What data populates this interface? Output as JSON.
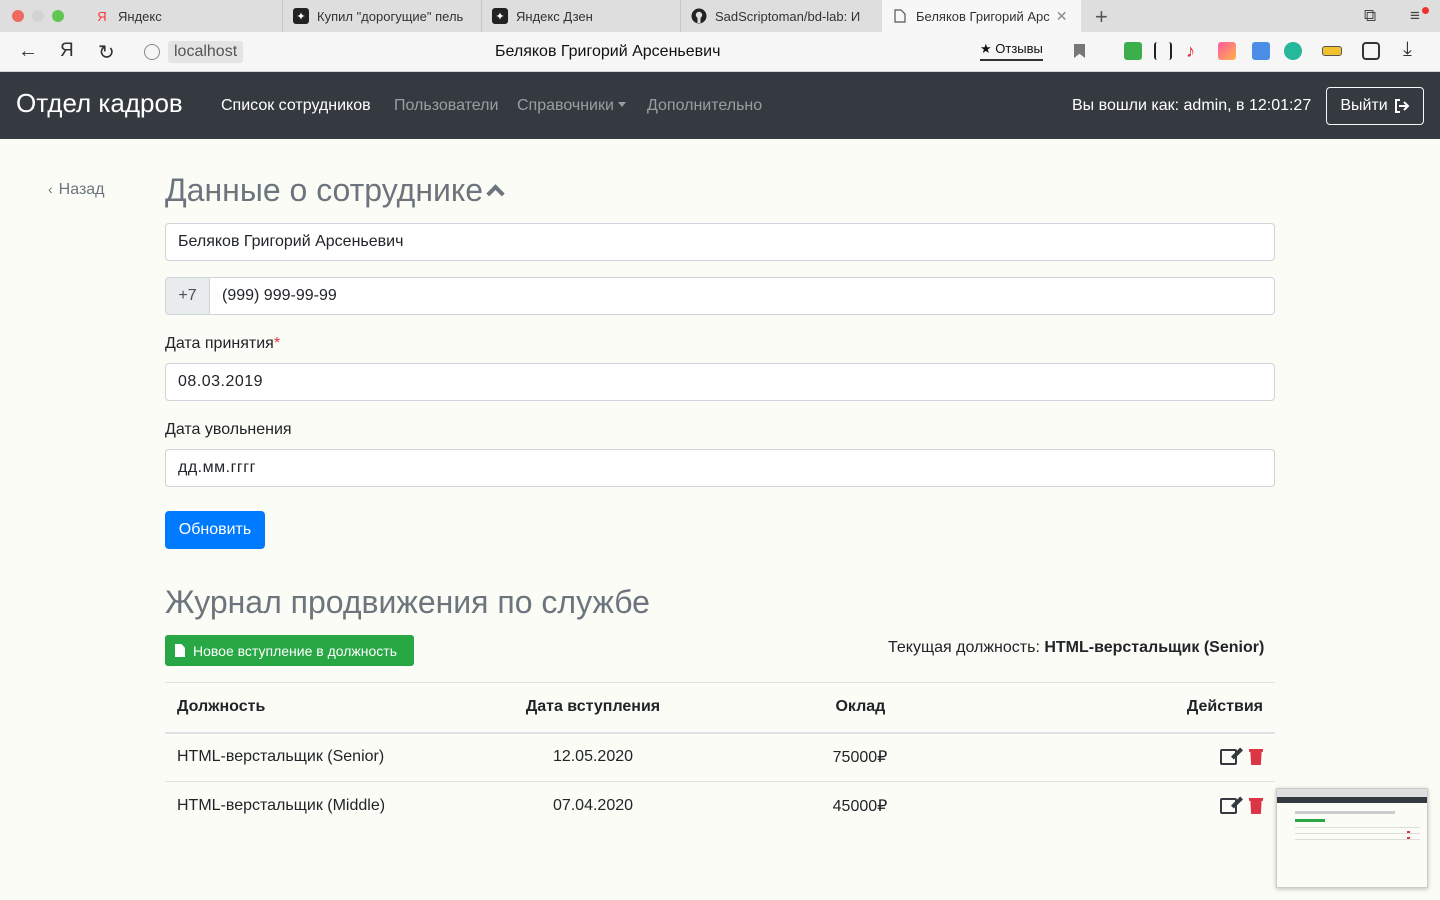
{
  "browser": {
    "tabs": [
      {
        "label": "Яндекс",
        "icon": "yandex-icon"
      },
      {
        "label": "Купил \"дорогущие\" пель",
        "icon": "zen-icon"
      },
      {
        "label": "Яндекс Дзен",
        "icon": "zen-icon"
      },
      {
        "label": "SadScriptoman/bd-lab: И",
        "icon": "github-icon"
      },
      {
        "label": "Беляков Григорий Арс",
        "icon": "page-icon",
        "active": true
      }
    ],
    "url_host": "localhost",
    "page_title": "Беляков Григорий Арсеньевич",
    "reviews_label": "★ Отзывы",
    "ya_label": "Я"
  },
  "app": {
    "brand": "Отдел кадров",
    "nav": {
      "employees": "Список сотрудников",
      "users": "Пользователи",
      "references": "Справочники",
      "extra": "Дополнительно"
    },
    "logged_in": "Вы вошли как: admin, в 12:01:27",
    "logout": "Выйти"
  },
  "page": {
    "back": "Назад",
    "title": "Данные о сотруднике",
    "form": {
      "full_name": "Беляков Григорий Арсеньевич",
      "phone_prefix": "+7",
      "phone": "(999) 999-99-99",
      "hire_date_label": "Дата принятия",
      "required_mark": "*",
      "hire_date": "08.03.2019",
      "dismissal_date_label": "Дата увольнения",
      "dismissal_date_placeholder": "дд.мм.гггг",
      "update_button": "Обновить"
    },
    "journal": {
      "title": "Журнал продвижения по службе",
      "new_button": "Новое вступление в должность",
      "current_label": "Текущая должность:",
      "current_value": "HTML-верстальщик (Senior)",
      "columns": [
        "Должность",
        "Дата вступления",
        "Оклад",
        "Действия"
      ],
      "rows": [
        {
          "position": "HTML-верстальщик (Senior)",
          "date": "12.05.2020",
          "salary": "75000₽"
        },
        {
          "position": "HTML-верстальщик (Middle)",
          "date": "07.04.2020",
          "salary": "45000₽"
        }
      ]
    }
  },
  "colors": {
    "navbar": "#343a40",
    "primary": "#007bff",
    "success": "#28a745",
    "danger": "#dc3545",
    "background": "#fbfcf5"
  }
}
